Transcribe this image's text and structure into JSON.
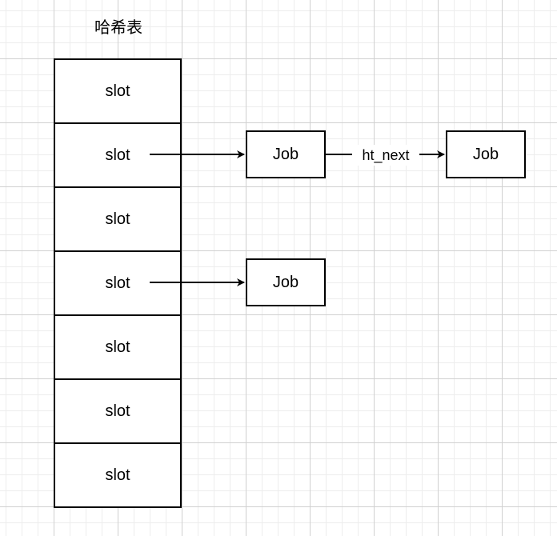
{
  "title": "哈希表",
  "hash_table": {
    "slots": [
      "slot",
      "slot",
      "slot",
      "slot",
      "slot",
      "slot",
      "slot"
    ]
  },
  "nodes": {
    "job1": "Job",
    "job2": "Job",
    "job3": "Job"
  },
  "edges": {
    "next_label": "ht_next"
  }
}
